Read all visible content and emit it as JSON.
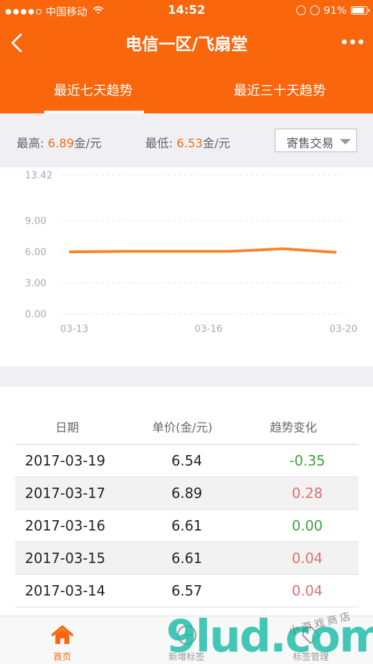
{
  "status_bar": {
    "carrier": "中国移动",
    "time": "14:52",
    "battery": "91%",
    "battery_level": 0.91
  },
  "nav": {
    "title": "电信一区/飞扇堂"
  },
  "tabs": [
    {
      "label": "最近七天趋势",
      "active": true
    },
    {
      "label": "最近三十天趋势",
      "active": false
    }
  ],
  "stats": {
    "high_label": "最高:",
    "high_value": "6.89",
    "high_unit": "金/元",
    "low_label": "最低:",
    "low_value": "6.53",
    "low_unit": "金/元",
    "select_value": "寄售交易"
  },
  "chart_data": {
    "type": "line",
    "y_ticks": [
      "13.42",
      "9.00",
      "6.00",
      "3.00",
      "0.00"
    ],
    "ylim": [
      0,
      13.42
    ],
    "x_ticks": [
      "03-13",
      "03-16",
      "03-20"
    ],
    "x": [
      "03-13",
      "03-14",
      "03-15",
      "03-16",
      "03-17",
      "03-19"
    ],
    "series": [
      {
        "values": [
          6.0,
          6.05,
          6.05,
          6.05,
          6.3,
          5.95
        ],
        "color": "#f7842b"
      }
    ]
  },
  "table": {
    "headers": [
      "日期",
      "单价(金/元)",
      "趋势变化"
    ],
    "rows": [
      {
        "date": "2017-03-19",
        "price": "6.54",
        "change": "-0.35",
        "trend": "down"
      },
      {
        "date": "2017-03-17",
        "price": "6.89",
        "change": "0.28",
        "trend": "up"
      },
      {
        "date": "2017-03-16",
        "price": "6.61",
        "change": "0.00",
        "trend": "flat"
      },
      {
        "date": "2017-03-15",
        "price": "6.61",
        "change": "0.04",
        "trend": "up"
      },
      {
        "date": "2017-03-14",
        "price": "6.57",
        "change": "0.04",
        "trend": "up"
      }
    ]
  },
  "tabbar": [
    {
      "label": "首页",
      "icon": "home-icon",
      "active": true
    },
    {
      "label": "新增标签",
      "icon": "add-tag-icon",
      "active": false
    },
    {
      "label": "标签管理",
      "icon": "tag-manage-icon",
      "active": false
    }
  ],
  "watermark": {
    "main": "9lud.com",
    "small": "小游戏商店"
  },
  "colors": {
    "accent": "#f9660b",
    "up": "#e07070",
    "down": "#3fa140"
  }
}
